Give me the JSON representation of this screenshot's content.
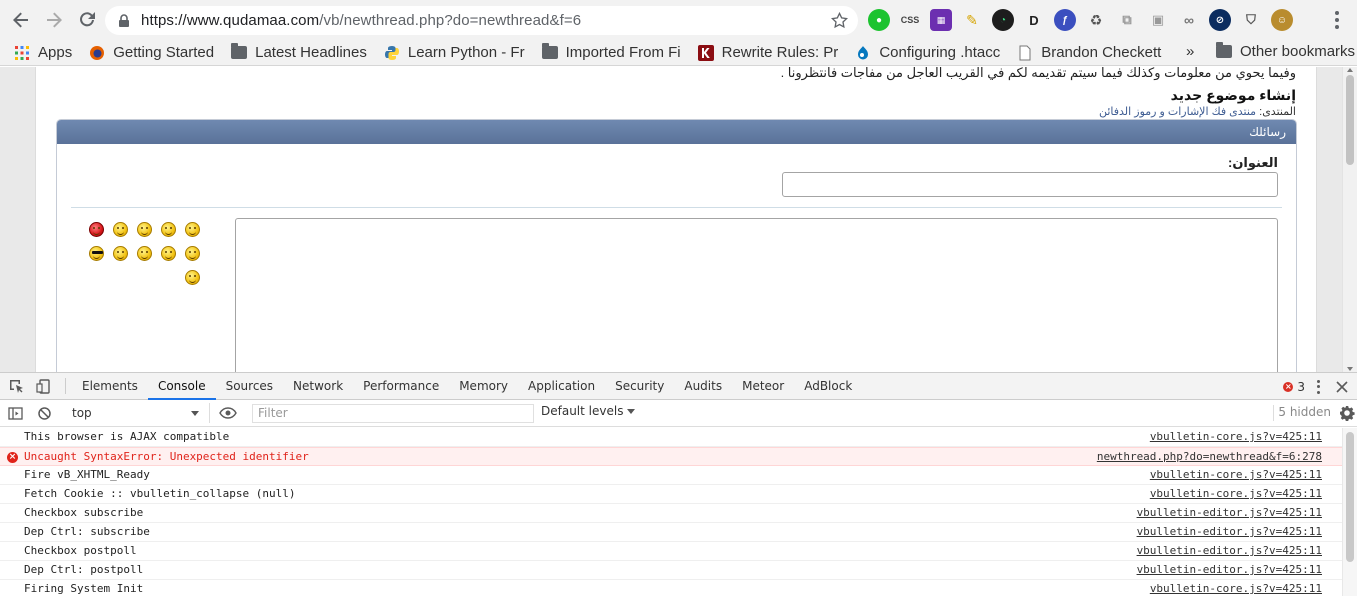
{
  "browser": {
    "url_host": "https://www.qudamaa.com",
    "url_path": "/vb/newthread.php?do=newthread&f=6"
  },
  "bookmarks": {
    "items": [
      {
        "label": "Apps",
        "icon": "apps-grid-icon"
      },
      {
        "label": "Getting Started",
        "icon": "firefox-icon"
      },
      {
        "label": "Latest Headlines",
        "icon": "folder-icon"
      },
      {
        "label": "Learn Python - Fr",
        "icon": "python-icon"
      },
      {
        "label": "Imported From Fi",
        "icon": "folder-icon"
      },
      {
        "label": "Rewrite Rules: Pr",
        "icon": "k-logo-icon"
      },
      {
        "label": "Configuring .htacc",
        "icon": "drupal-icon"
      },
      {
        "label": "Brandon Checkett",
        "icon": "page-icon"
      }
    ],
    "more": "»",
    "other": "Other bookmarks"
  },
  "page": {
    "intro": "وفيما يحوي من معلومات وكذلك فيما سيتم تقديمه لكم في القريب العاجل من مفاجآت فانتظرونا .",
    "title": "إنشاء موضوع جديد",
    "forum_label": "المنتدى:",
    "forum_link": "منتدى فك الإشارات و رموز الدفائن",
    "panel_title": "رسائلك",
    "subject_label": "العنوان:"
  },
  "devtools": {
    "tabs": [
      "Elements",
      "Console",
      "Sources",
      "Network",
      "Performance",
      "Memory",
      "Application",
      "Security",
      "Audits",
      "Meteor",
      "AdBlock"
    ],
    "active_tab": "Console",
    "error_count": "3",
    "context": "top",
    "filter_placeholder": "Filter",
    "levels": "Default levels",
    "hidden": "5 hidden",
    "messages": [
      {
        "text": "This browser is AJAX compatible",
        "source": "vbulletin-core.js?v=425:11",
        "level": "log"
      },
      {
        "text": "Uncaught SyntaxError: Unexpected identifier",
        "source": "newthread.php?do=newthread&f=6:278",
        "level": "error"
      },
      {
        "text": "Fire vB_XHTML_Ready",
        "source": "vbulletin-core.js?v=425:11",
        "level": "log"
      },
      {
        "text": "Fetch Cookie :: vbulletin_collapse (null)",
        "source": "vbulletin-core.js?v=425:11",
        "level": "log"
      },
      {
        "text": "Checkbox subscribe",
        "source": "vbulletin-editor.js?v=425:11",
        "level": "log"
      },
      {
        "text": "Dep Ctrl: subscribe",
        "source": "vbulletin-editor.js?v=425:11",
        "level": "log"
      },
      {
        "text": "Checkbox postpoll",
        "source": "vbulletin-editor.js?v=425:11",
        "level": "log"
      },
      {
        "text": "Dep Ctrl: postpoll",
        "source": "vbulletin-editor.js?v=425:11",
        "level": "log"
      },
      {
        "text": "Firing System Init",
        "source": "vbulletin-core.js?v=425:11",
        "level": "log"
      }
    ]
  }
}
